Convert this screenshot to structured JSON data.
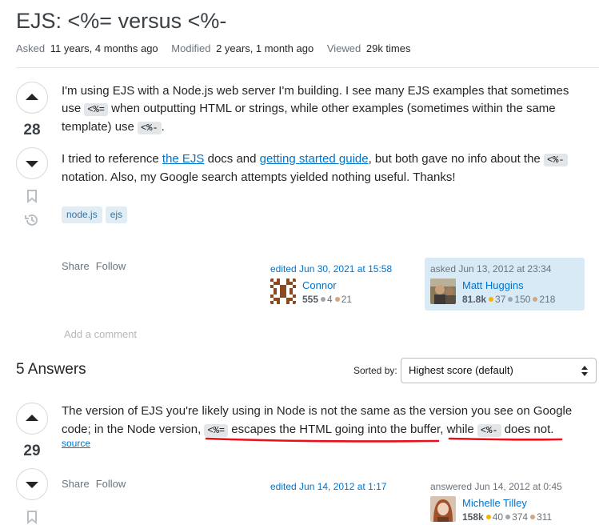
{
  "question": {
    "title": "EJS: <%= versus <%-",
    "meta": {
      "asked_label": "Asked",
      "asked_value": "11 years, 4 months ago",
      "modified_label": "Modified",
      "modified_value": "2 years, 1 month ago",
      "viewed_label": "Viewed",
      "viewed_value": "29k times"
    },
    "score": "28",
    "body": {
      "p1_a": "I'm using EJS with a Node.js web server I'm building. I see many EJS examples that sometimes use ",
      "p1_code1": "<%=",
      "p1_b": " when outputting HTML or strings, while other examples (sometimes within the same template) use ",
      "p1_code2": "<%-",
      "p1_c": ".",
      "p2_a": "I tried to reference ",
      "p2_link1": "the EJS",
      "p2_b": " docs and ",
      "p2_link2": "getting started guide",
      "p2_c": ", but both gave no info about the ",
      "p2_code": "<%-",
      "p2_d": " notation. Also, my Google search attempts yielded nothing useful. Thanks!"
    },
    "tags": [
      "node.js",
      "ejs"
    ],
    "share_label": "Share",
    "follow_label": "Follow",
    "editor": {
      "edited_text": "edited Jun 30, 2021 at 15:58",
      "name": "Connor",
      "rep": "555",
      "silver": "4",
      "bronze": "21"
    },
    "asker": {
      "asked_text": "asked Jun 13, 2012 at 23:34",
      "name": "Matt Huggins",
      "rep": "81.8k",
      "gold": "37",
      "silver": "150",
      "bronze": "218"
    },
    "add_comment": "Add a comment"
  },
  "answers_header": {
    "count_text": "5 Answers",
    "sorted_label": "Sorted by:",
    "sort_value": "Highest score (default)"
  },
  "answer": {
    "score": "29",
    "body": {
      "a": "The version of EJS you're likely using in Node is not the same as the version you see on Google code; in the Node version, ",
      "code1": "<%=",
      "b": " escapes the HTML going into the buffer, while ",
      "code2": "<%-",
      "c": " does not."
    },
    "source_link": "source",
    "share_label": "Share",
    "follow_label": "Follow",
    "edited_text": "edited Jun 14, 2012 at 1:17",
    "answerer": {
      "answered_text": "answered Jun 14, 2012 at 0:45",
      "name": "Michelle Tilley",
      "rep": "158k",
      "gold": "40",
      "silver": "374",
      "bronze": "311"
    }
  },
  "colors": {
    "link": "#0074cc",
    "tag_bg": "#e1ecf4",
    "tag_text": "#39739d",
    "asked_card_bg": "#d9eaf7",
    "annotation_red": "#e8101a",
    "gold": "#f1b600",
    "silver": "#9fa6ad",
    "bronze": "#d1a684"
  }
}
